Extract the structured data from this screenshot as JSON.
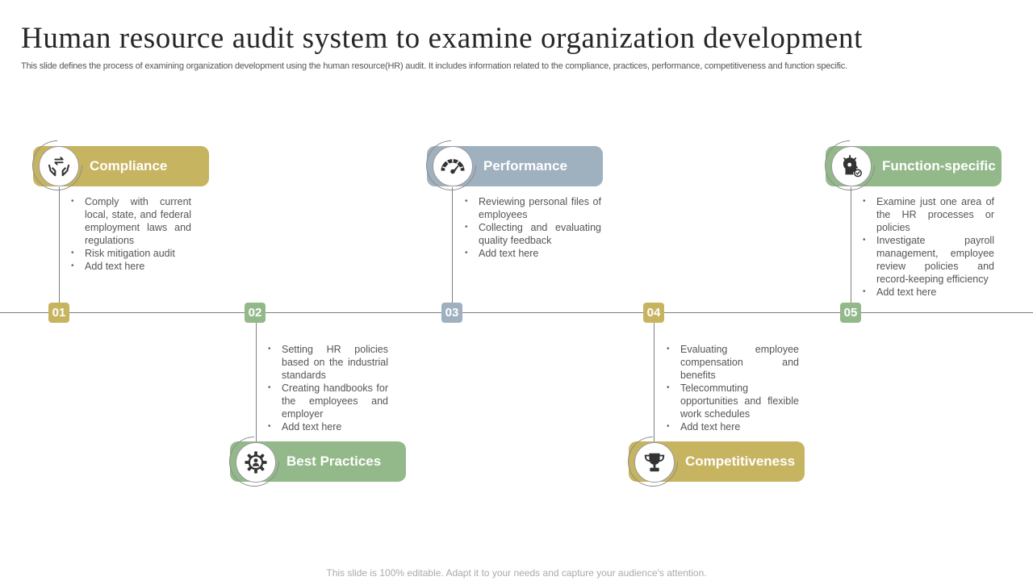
{
  "title": "Human resource audit system to examine organization development",
  "subtitle": "This slide defines the process of examining organization development using the human resource(HR) audit. It includes information related to the compliance, practices, performance, competitiveness and function specific.",
  "footer": "This slide is 100% editable. Adapt it to your needs and capture your audience's attention.",
  "colors": {
    "gold": "#c7b460",
    "blue": "#9fb0bf",
    "green": "#93b98a",
    "line": "#7f7f7f"
  },
  "steps": [
    {
      "number": "01",
      "label": "Compliance",
      "icon": "hands-exchange-icon",
      "points": [
        "Comply with current local, state, and federal employment laws and regulations",
        "Risk mitigation audit",
        "Add text here"
      ]
    },
    {
      "number": "02",
      "label": "Best Practices",
      "icon": "gear-person-icon",
      "points": [
        "Setting HR policies based on the industrial standards",
        "Creating handbooks for the employees and employer",
        "Add text here"
      ]
    },
    {
      "number": "03",
      "label": "Performance",
      "icon": "speedometer-icon",
      "points": [
        "Reviewing personal files of employees",
        "Collecting and evaluating quality feedback",
        "Add text here"
      ]
    },
    {
      "number": "04",
      "label": "Competitiveness",
      "icon": "trophy-icon",
      "points": [
        "Evaluating employee compensation and benefits",
        "Telecommuting opportunities and flexible work schedules",
        "Add text here"
      ]
    },
    {
      "number": "05",
      "label": "Function-specific",
      "icon": "idea-head-icon",
      "points": [
        "Examine just one area of the HR processes or policies",
        "Investigate payroll management, employee review policies and record-keeping efficiency",
        "Add text here"
      ]
    }
  ]
}
